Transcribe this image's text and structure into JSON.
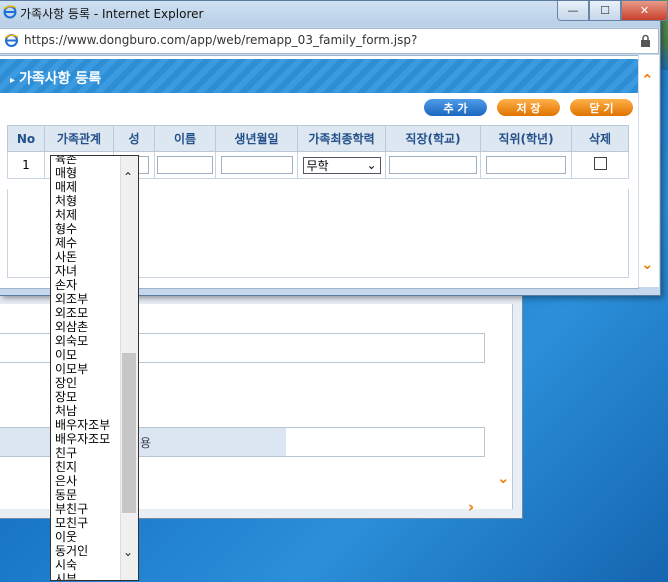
{
  "window": {
    "title": "가족사항 등록 - Internet Explorer",
    "url": "https://www.dongburo.com/app/web/remapp_03_family_form.jsp?",
    "controls": {
      "minimize": "—",
      "maximize": "☐",
      "close": "✕"
    }
  },
  "header": {
    "title": "가족사항 등록"
  },
  "buttons": {
    "add": "추 가",
    "save": "저 장",
    "close": "닫 기"
  },
  "table": {
    "columns": [
      "No",
      "가족관계",
      "성",
      "이름",
      "생년월일",
      "가족최종학력",
      "직장(학교)",
      "직위(학년)",
      "삭제"
    ],
    "rows": [
      {
        "no": "1",
        "education": "무학"
      }
    ]
  },
  "dropdown": {
    "items": [
      "육촌",
      "매형",
      "매제",
      "처형",
      "처제",
      "형수",
      "제수",
      "사돈",
      "자녀",
      "손자",
      "외조부",
      "외조모",
      "외삼촌",
      "외숙모",
      "이모",
      "이모부",
      "장인",
      "장모",
      "처남",
      "배우자조부",
      "배우자조모",
      "친구",
      "친지",
      "은사",
      "동문",
      "부친구",
      "모친구",
      "이웃",
      "동거인",
      "시숙",
      "시부"
    ]
  },
  "background_window": {
    "field_text": "용"
  },
  "colors": {
    "accent_blue": "#2d8ed6",
    "accent_orange": "#f07a00"
  }
}
